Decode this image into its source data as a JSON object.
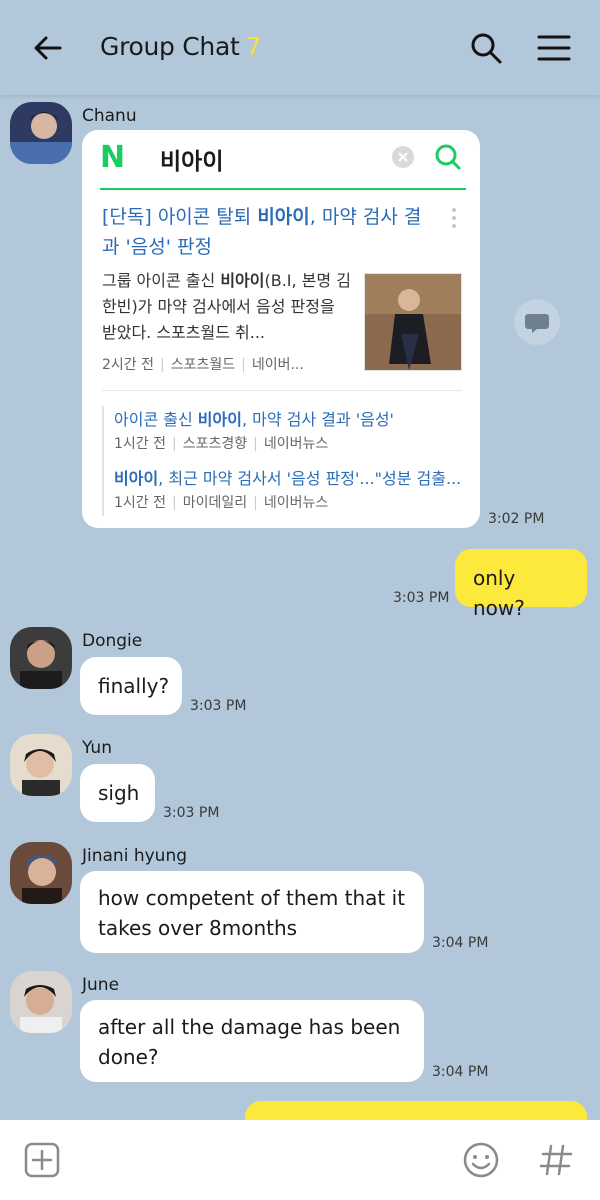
{
  "header": {
    "title": "Group Chat",
    "member_count": "7",
    "back_icon": "arrow-left-icon",
    "search_icon": "search-icon",
    "menu_icon": "hamburger-menu-icon"
  },
  "colors": {
    "background": "#b2c7da",
    "my_bubble": "#fde93c",
    "their_bubble": "#ffffff",
    "naver_green": "#19ce60",
    "link_blue": "#2a6cb8"
  },
  "messages": [
    {
      "sender": "Chanu",
      "time": "3:02 PM",
      "card": {
        "search_query": "비아이",
        "headline_pre": "[단독] 아이콘 탈퇴 ",
        "headline_bold": "비아이",
        "headline_post": ", 마약 검사 결과 '음성' 판정",
        "snippet_pre": "그룹 아이콘 출신 ",
        "snippet_bold": "비아이",
        "snippet_post": "(B.I, 본명 김한빈)가 마약 검사에서 음성 판정을 받았다. 스포츠월드 취...",
        "meta": [
          "2시간 전",
          "스포츠월드",
          "네이버..."
        ],
        "related": [
          {
            "title_pre": "아이콘 출신 ",
            "title_bold": "비아이",
            "title_post": ", 마약 검사 결과 '음성'",
            "meta": [
              "1시간 전",
              "스포츠경향",
              "네이버뉴스"
            ]
          },
          {
            "title_pre": "",
            "title_bold": "비아이",
            "title_post": ", 최근 마약 검사서 '음성 판정'...\"성분 검출...",
            "meta": [
              "1시간 전",
              "마이데일리",
              "네이버뉴스"
            ]
          }
        ]
      }
    },
    {
      "sender": "me",
      "text": "only now?",
      "time": "3:03 PM"
    },
    {
      "sender": "Dongie",
      "text": "finally?",
      "time": "3:03 PM"
    },
    {
      "sender": "Yun",
      "text": "sigh",
      "time": "3:03 PM"
    },
    {
      "sender": "Jinani hyung",
      "text": "how competent of them that it takes over 8months",
      "time": "3:04 PM"
    },
    {
      "sender": "June",
      "text": "after all the damage has been done?",
      "time": "3:04 PM"
    }
  ],
  "footer": {
    "add_icon": "plus-square-icon",
    "emoji_icon": "smiley-icon",
    "hash_icon": "hashtag-icon"
  }
}
